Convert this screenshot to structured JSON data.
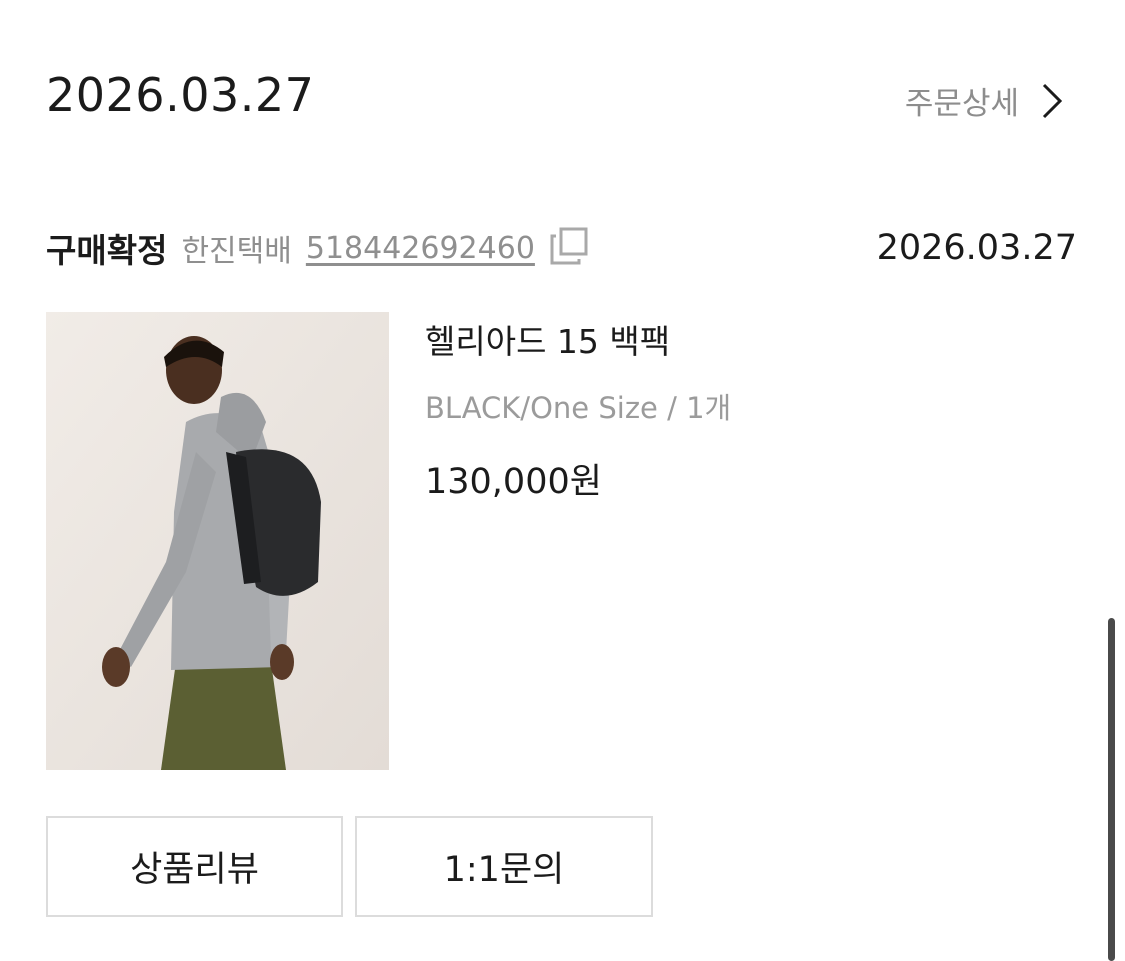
{
  "order": {
    "date": "2026.03.27",
    "detail_label": "주문상세",
    "detail_icon": "chevron-right-icon"
  },
  "shipment": {
    "status": "구매확정",
    "carrier": "한진택배",
    "tracking_number": "518442692460",
    "copy_icon": "copy-icon",
    "date": "2026.03.27"
  },
  "product": {
    "name": "헬리아드 15 백팩",
    "option": "BLACK/One Size / 1개",
    "price": "130,000원",
    "image": "product-photo"
  },
  "actions": {
    "review_label": "상품리뷰",
    "inquiry_label": "1:1문의"
  },
  "colors": {
    "text_primary": "#1b1b1b",
    "text_secondary": "#8f8f8f",
    "border": "#dcdcdc",
    "background": "#ffffff"
  }
}
